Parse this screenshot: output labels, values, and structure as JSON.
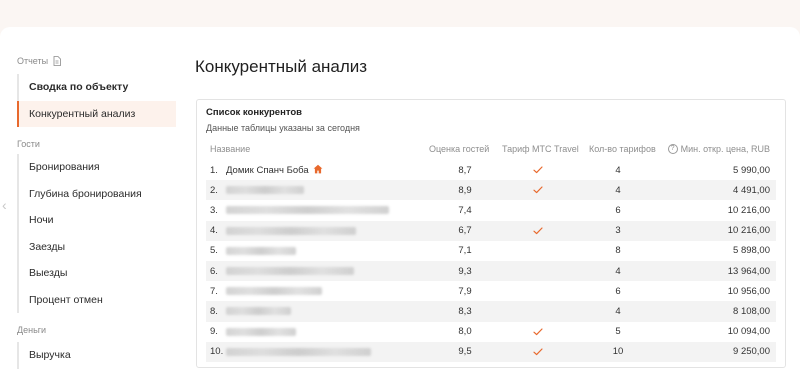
{
  "sidebar": {
    "groups": [
      {
        "label": "Отчеты",
        "items": [
          {
            "label": "Сводка по объекту",
            "bold": true,
            "active": false
          },
          {
            "label": "Конкурентный анализ",
            "bold": false,
            "active": true
          }
        ]
      },
      {
        "label": "Гости",
        "items": [
          {
            "label": "Бронирования"
          },
          {
            "label": "Глубина бронирования"
          },
          {
            "label": "Ночи"
          },
          {
            "label": "Заезды"
          },
          {
            "label": "Выезды"
          },
          {
            "label": "Процент отмен"
          }
        ]
      },
      {
        "label": "Деньги",
        "items": [
          {
            "label": "Выручка"
          }
        ]
      }
    ]
  },
  "main": {
    "title": "Конкурентный анализ",
    "card": {
      "title": "Список конкурентов",
      "subtitle": "Данные таблицы указаны за сегодня",
      "columns": {
        "name": "Название",
        "rating": "Оценка гостей",
        "tariff": "Тариф МТС Travel",
        "count": "Кол-во тарифов",
        "price": "Мин. откр. цена, RUB"
      },
      "rows": [
        {
          "num": "1.",
          "name": "Домик Спанч Боба",
          "home": true,
          "rating": "8,7",
          "tariff": true,
          "count": "4",
          "price": "5 990,00"
        },
        {
          "num": "2.",
          "name": "",
          "rating": "8,9",
          "tariff": true,
          "count": "4",
          "price": "4 491,00"
        },
        {
          "num": "3.",
          "name": "",
          "rating": "7,4",
          "tariff": false,
          "count": "6",
          "price": "10 216,00"
        },
        {
          "num": "4.",
          "name": "",
          "rating": "6,7",
          "tariff": true,
          "count": "3",
          "price": "10 216,00"
        },
        {
          "num": "5.",
          "name": "",
          "rating": "7,1",
          "tariff": false,
          "count": "8",
          "price": "5 898,00"
        },
        {
          "num": "6.",
          "name": "",
          "rating": "9,3",
          "tariff": false,
          "count": "4",
          "price": "13 964,00"
        },
        {
          "num": "7.",
          "name": "",
          "rating": "7,9",
          "tariff": false,
          "count": "6",
          "price": "10 956,00"
        },
        {
          "num": "8.",
          "name": "",
          "rating": "8,3",
          "tariff": false,
          "count": "4",
          "price": "8 108,00"
        },
        {
          "num": "9.",
          "name": "",
          "rating": "8,0",
          "tariff": true,
          "count": "5",
          "price": "10 094,00"
        },
        {
          "num": "10.",
          "name": "",
          "rating": "9,5",
          "tariff": true,
          "count": "10",
          "price": "9 250,00"
        }
      ]
    }
  },
  "icons": {
    "reports": "document-icon",
    "home": "home-icon",
    "check": "check-icon",
    "info": "question-circle-icon",
    "scroll": "chevron-left-icon"
  },
  "colors": {
    "accent": "#e8692d",
    "stripe": "#f3f3f3",
    "activeBg": "#fdf2ec"
  }
}
